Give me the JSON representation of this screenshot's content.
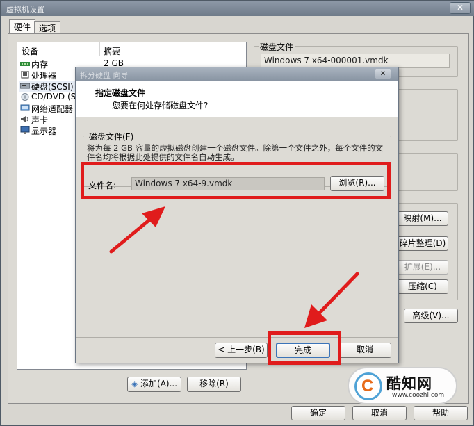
{
  "window": {
    "title": "虚拟机设置",
    "close_glyph": "✕"
  },
  "tabs": [
    {
      "label": "硬件",
      "active": true
    },
    {
      "label": "选项",
      "active": false
    }
  ],
  "device_list": {
    "col_device": "设备",
    "col_summary": "摘要",
    "items": [
      {
        "name": "内存",
        "summary": "2 GB",
        "icon": "memory-icon"
      },
      {
        "name": "处理器",
        "summary": "",
        "icon": "processor-icon"
      },
      {
        "name": "硬盘(SCSI)",
        "summary": "",
        "icon": "hard-disk-icon",
        "selected": true
      },
      {
        "name": "CD/DVD (SA",
        "summary": "",
        "icon": "cd-dvd-icon"
      },
      {
        "name": "网络适配器",
        "summary": "",
        "icon": "network-adapter-icon"
      },
      {
        "name": "声卡",
        "summary": "",
        "icon": "sound-card-icon"
      },
      {
        "name": "显示器",
        "summary": "",
        "icon": "display-icon"
      }
    ],
    "add_label": "添加(A)...",
    "remove_label": "移除(R)"
  },
  "disk_file": {
    "group_title": "磁盘文件",
    "value": "Windows 7 x64-000001.vmdk"
  },
  "utilities": {
    "map_label": "映射(M)...",
    "defrag_label": "碎片整理(D)",
    "expand_label": "扩展(E)...",
    "compress_label": "压缩(C)",
    "advanced_label": "高级(V)..."
  },
  "footer": {
    "ok_label": "确定",
    "cancel_label": "取消",
    "help_label": "帮助"
  },
  "dialog": {
    "title": "拆分硬盘 向导",
    "close_glyph": "✕",
    "heading": "指定磁盘文件",
    "subheading": "您要在何处存储磁盘文件?",
    "fieldset_title": "磁盘文件(F)",
    "description": "将为每 2 GB 容量的虚拟磁盘创建一个磁盘文件。除第一个文件之外，每个文件的文件名均将根据此处提供的文件名自动生成。",
    "file_name_label": "文件名:",
    "file_name_value": "Windows 7 x64-9.vmdk",
    "browse_label": "浏览(R)...",
    "back_label": "< 上一步(B)",
    "finish_label": "完成",
    "cancel_label": "取消"
  },
  "watermark": {
    "name": "酷知网",
    "url": "www.coozhi.com",
    "logo_letter": "C"
  },
  "colors": {
    "annotation": "#e01c1c",
    "accent": "#3b74b8"
  }
}
